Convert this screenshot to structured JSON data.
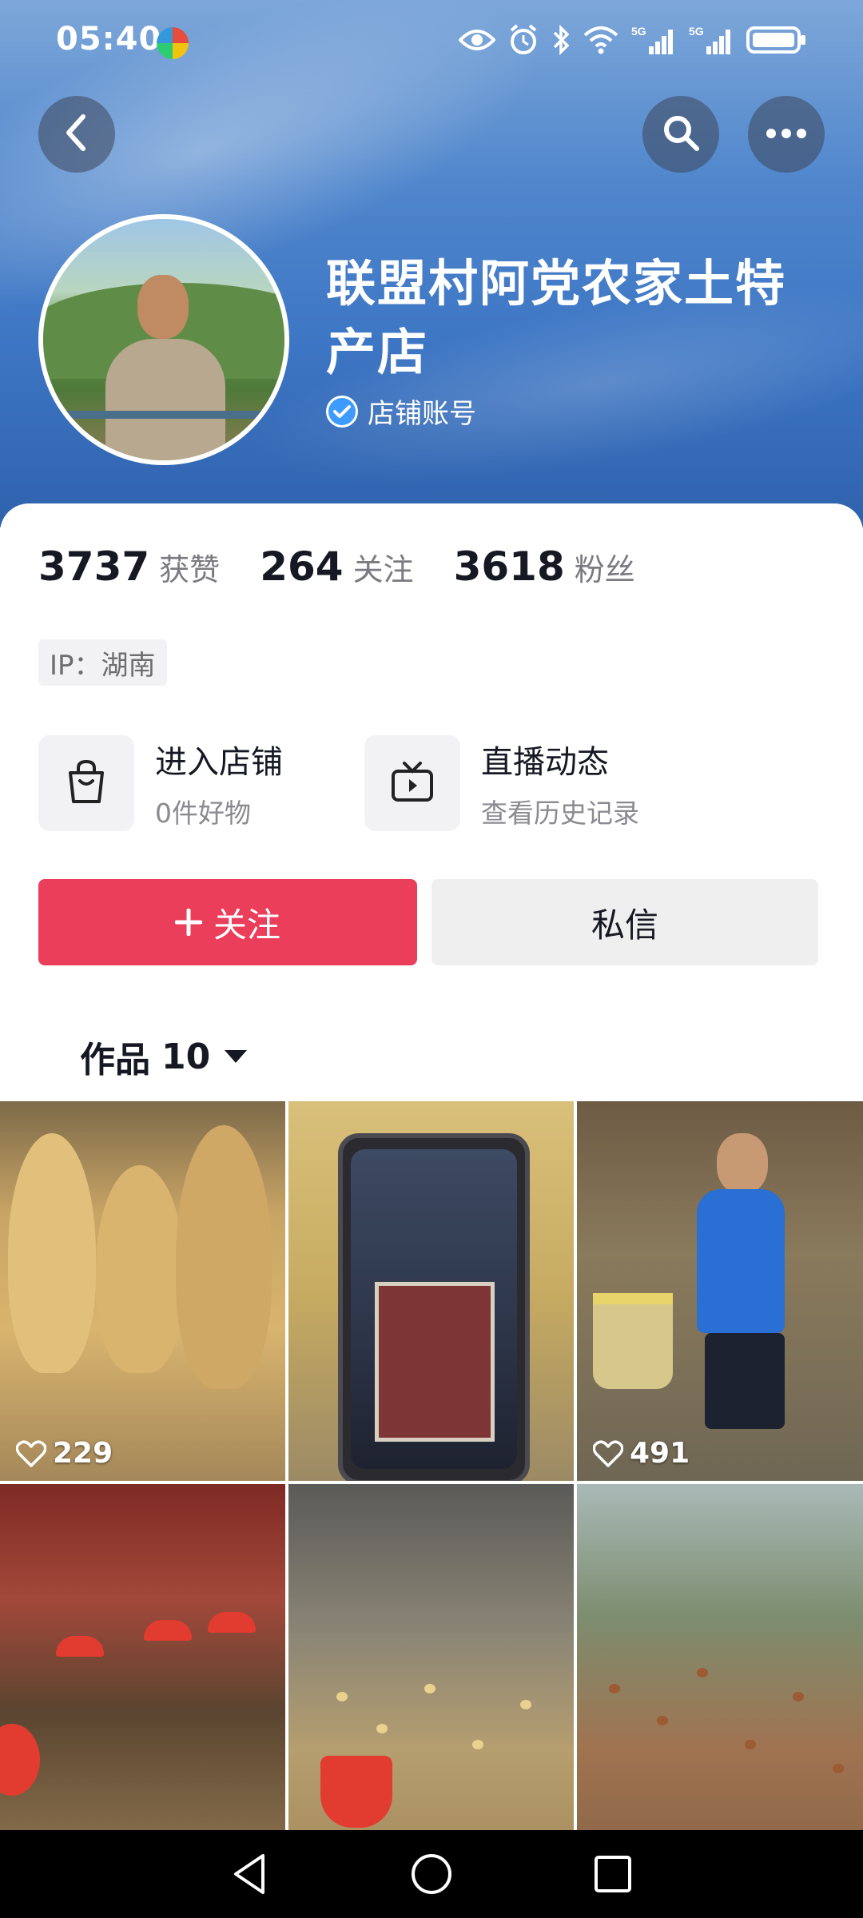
{
  "status_bar": {
    "time": "05:40",
    "icons": [
      "eye-icon",
      "alarm-icon",
      "bluetooth-icon",
      "wifi-icon",
      "signal-5g-icon",
      "signal-5g-icon",
      "battery-icon"
    ],
    "signal_label_1": "5G",
    "signal_label_2": "5G"
  },
  "header": {
    "back_icon": "chevron-left-icon",
    "search_icon": "search-icon",
    "more_icon": "more-icon"
  },
  "profile": {
    "shop_name": "联盟村阿党农家土特产店",
    "verified_label": "店铺账号"
  },
  "stats": [
    {
      "value": "3737",
      "label": "获赞"
    },
    {
      "value": "264",
      "label": "关注"
    },
    {
      "value": "3618",
      "label": "粉丝"
    }
  ],
  "ip_label": "IP：湖南",
  "features": {
    "shop": {
      "title": "进入店铺",
      "subtitle": "0件好物",
      "icon": "shopping-bag-icon"
    },
    "live": {
      "title": "直播动态",
      "subtitle": "查看历史记录",
      "icon": "tv-icon"
    }
  },
  "actions": {
    "follow_label": "关注",
    "message_label": "私信"
  },
  "works": {
    "label": "作品",
    "count": "10"
  },
  "grid": [
    {
      "likes": "229"
    },
    {
      "likes": ""
    },
    {
      "likes": "491"
    },
    {
      "likes": ""
    },
    {
      "likes": ""
    },
    {
      "likes": ""
    }
  ],
  "colors": {
    "follow_button": "#ea3e5b",
    "hero_blue": "#3d76c4",
    "verified_blue": "#3e9bff"
  }
}
